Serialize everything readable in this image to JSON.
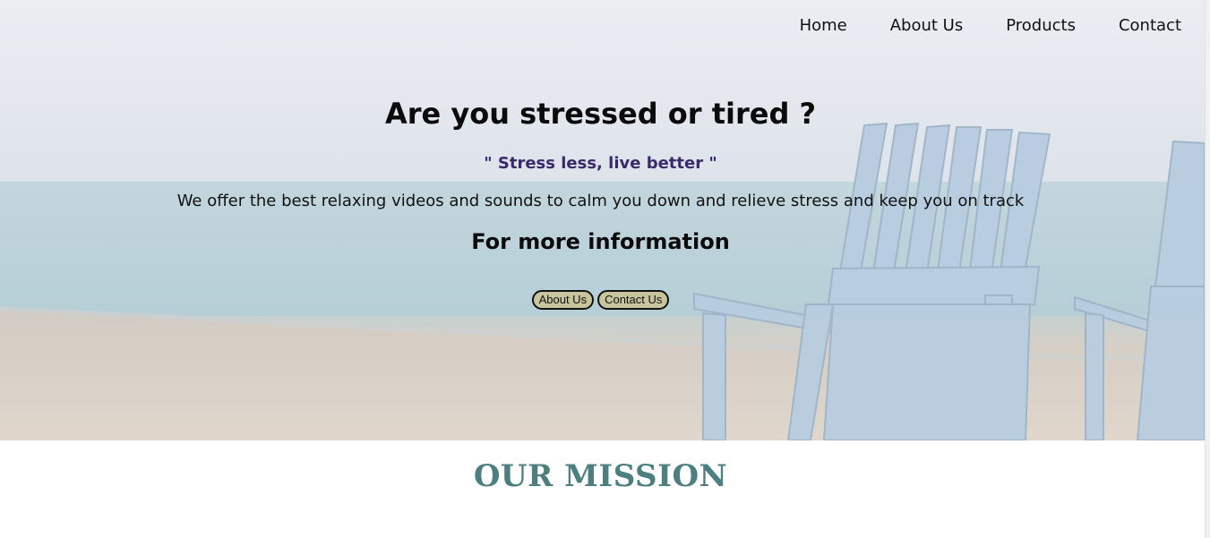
{
  "nav": {
    "items": [
      {
        "label": "Home"
      },
      {
        "label": "About Us"
      },
      {
        "label": "Products"
      },
      {
        "label": "Contact"
      }
    ]
  },
  "hero": {
    "headline": "Are you stressed or tired ?",
    "tagline": "\" Stress less, live better \"",
    "description": "We offer the best relaxing videos and sounds to calm you down and relieve stress and keep you on track",
    "more_info": "For more information",
    "buttons": {
      "about_label": "About Us",
      "contact_label": "Contact Us"
    },
    "background_image": "beach-adirondack-chairs"
  },
  "mission": {
    "title": "OUR MISSION"
  },
  "colors": {
    "tagline": "#3b2a6b",
    "mission": "#4d7f80",
    "button_bg": "#c8c59e"
  }
}
